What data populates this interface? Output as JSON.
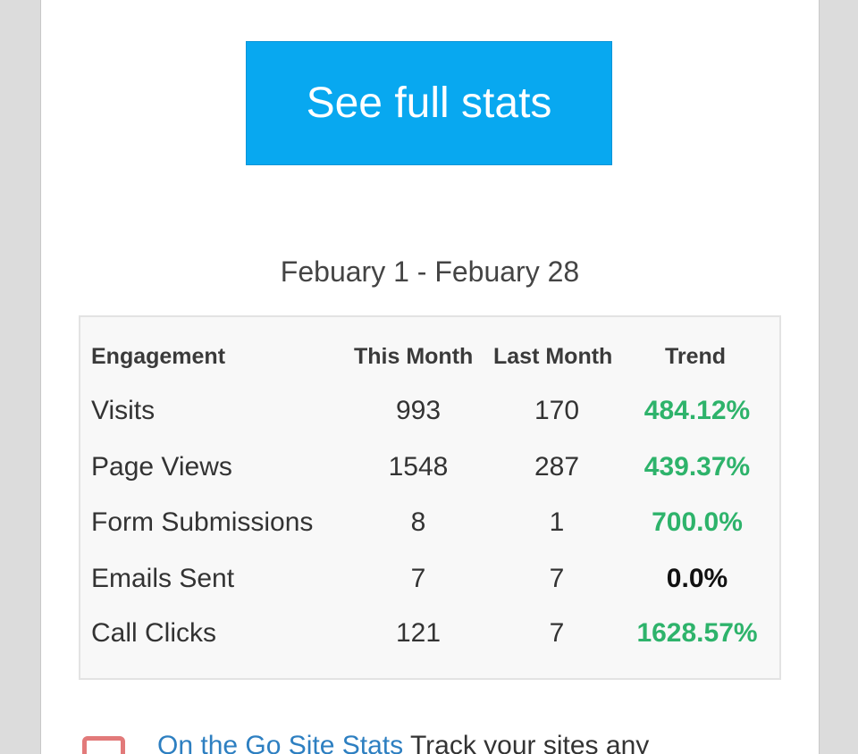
{
  "cta": {
    "label": "See full stats"
  },
  "date_range": "Febuary 1 - Febuary 28",
  "table": {
    "headers": [
      "Engagement",
      "This Month",
      "Last Month",
      "Trend"
    ],
    "rows": [
      {
        "label": "Visits",
        "this_month": "993",
        "last_month": "170",
        "trend": "484.12%"
      },
      {
        "label": "Page Views",
        "this_month": "1548",
        "last_month": "287",
        "trend": "439.37%"
      },
      {
        "label": "Form Submissions",
        "this_month": "8",
        "last_month": "1",
        "trend": "700.0%"
      },
      {
        "label": "Emails Sent",
        "this_month": "7",
        "last_month": "7",
        "trend": "0.0%"
      },
      {
        "label": "Call Clicks",
        "this_month": "121",
        "last_month": "7",
        "trend": "1628.57%"
      }
    ]
  },
  "footer": {
    "link_text": "On the Go Site Stats",
    "trailing_text": " Track your sites any"
  },
  "colors": {
    "cta_background": "#08a8f0",
    "trend_positive": "#2eb36b",
    "trend_neutral": "#111111",
    "link": "#2d7fc1"
  }
}
